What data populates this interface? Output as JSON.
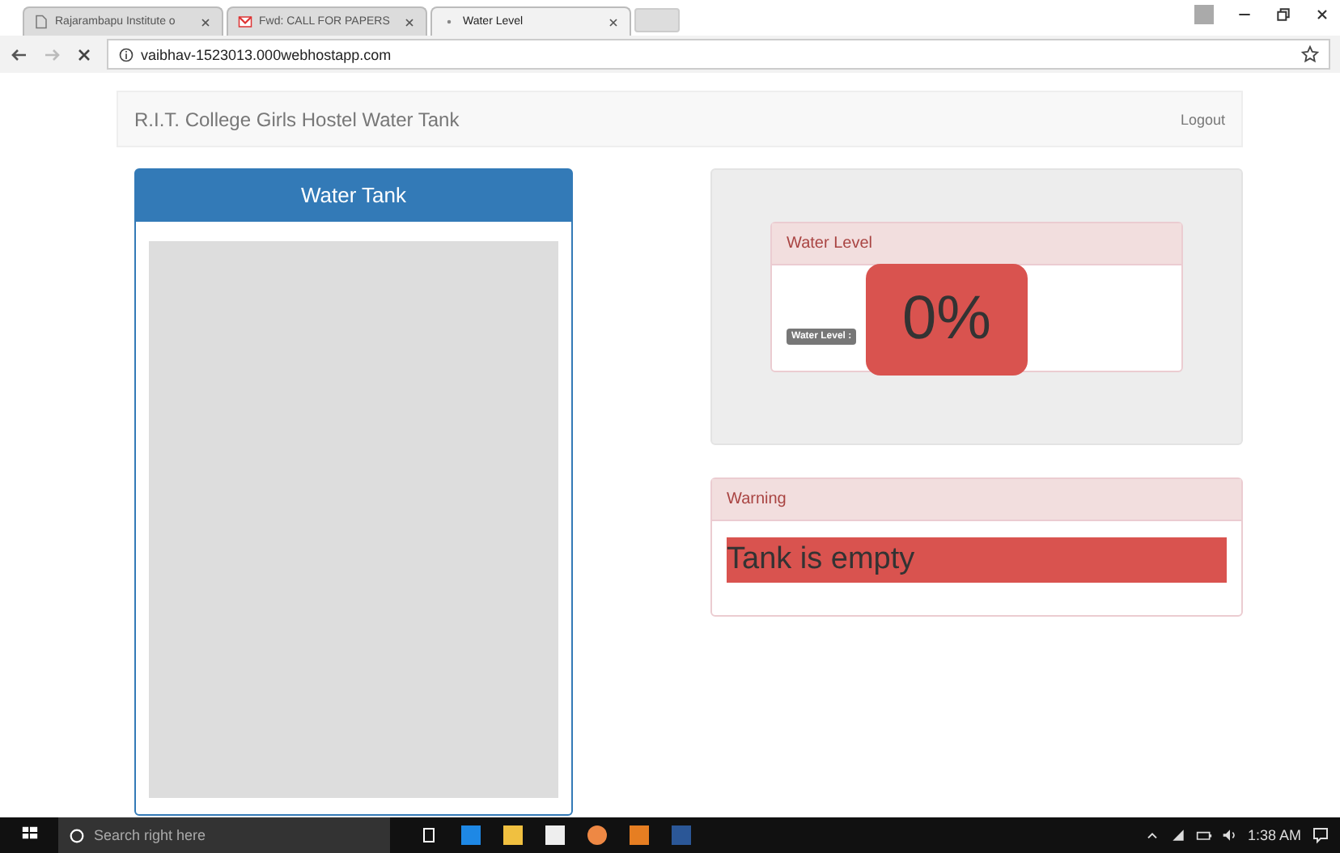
{
  "browser": {
    "tabs": [
      {
        "label": "Rajarambapu Institute o",
        "selected": false,
        "kind": "page"
      },
      {
        "label": "Fwd: CALL FOR PAPERS",
        "selected": false,
        "kind": "mail"
      },
      {
        "label": "Water Level",
        "selected": true,
        "kind": "loading"
      }
    ],
    "address": "vaibhav-1523013.000webhostapp.com"
  },
  "navbar": {
    "brand": "R.I.T. College Girls Hostel Water Tank",
    "logout": "Logout"
  },
  "water_tank": {
    "title": "Water Tank"
  },
  "level_panel": {
    "title": "Water Level",
    "badge": "Water Level :",
    "percent": "0%"
  },
  "warning": {
    "title": "Warning",
    "message": "Tank is empty"
  },
  "taskbar": {
    "search_placeholder": "Search right here",
    "time": "1:38 AM"
  }
}
